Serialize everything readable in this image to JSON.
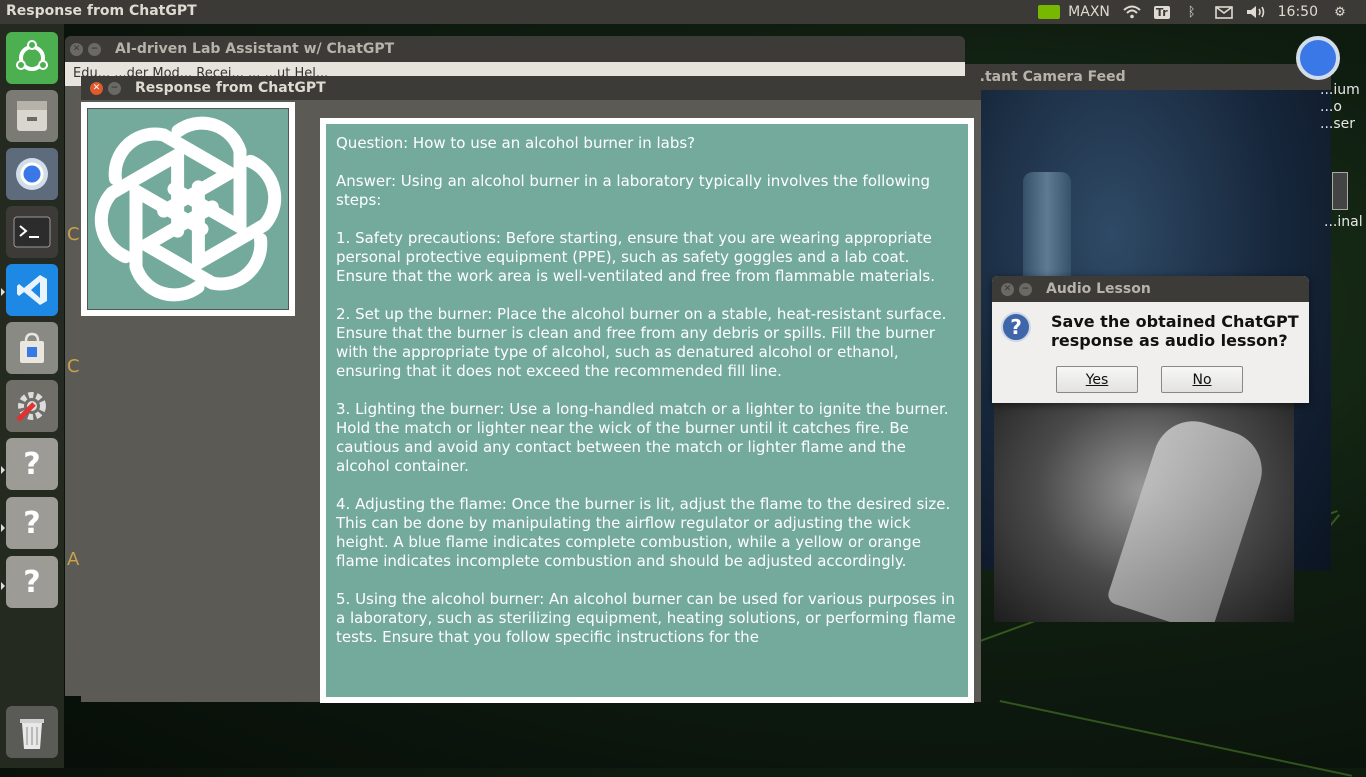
{
  "topbar": {
    "title": "Response from ChatGPT",
    "tray": {
      "maxn_label": "MAXN",
      "tr_label": "Tr",
      "time": "16:50"
    }
  },
  "launcher": {
    "items": [
      {
        "name": "ubuntu-dash-icon"
      },
      {
        "name": "files-icon"
      },
      {
        "name": "chromium-icon"
      },
      {
        "name": "terminal-icon"
      },
      {
        "name": "vscode-icon"
      },
      {
        "name": "software-center-icon"
      },
      {
        "name": "system-settings-icon"
      },
      {
        "name": "unknown-app-icon"
      },
      {
        "name": "unknown-app-icon"
      },
      {
        "name": "unknown-app-icon"
      },
      {
        "name": "trash-icon"
      }
    ]
  },
  "background_window": {
    "title": "AI-driven Lab Assistant w/ ChatGPT",
    "menu_text": "Edu... ...der Mod... Recei... ... ...ut Hel...",
    "side_chars": [
      "C",
      "C",
      "A"
    ]
  },
  "camera_window": {
    "title": "...tant Camera Feed"
  },
  "desktop": {
    "chromium_label_parts": [
      "...ium",
      "...o",
      "...ser"
    ],
    "terminal_label": "...inal"
  },
  "response_window": {
    "title": "Response from ChatGPT",
    "paragraphs": [
      "Question: How to use an alcohol burner in labs?",
      "Answer: Using an alcohol burner in a laboratory typically involves the following steps:",
      "1. Safety precautions: Before starting, ensure that you are wearing appropriate personal protective equipment (PPE), such as safety goggles and a lab coat. Ensure that the work area is well-ventilated and free from flammable materials.",
      "2. Set up the burner: Place the alcohol burner on a stable, heat-resistant surface. Ensure that the burner is clean and free from any debris or spills. Fill the burner with the appropriate type of alcohol, such as denatured alcohol or ethanol, ensuring that it does not exceed the recommended fill line.",
      "3. Lighting the burner: Use a long-handled match or a lighter to ignite the burner. Hold the match or lighter near the wick of the burner until it catches fire. Be cautious and avoid any contact between the match or lighter flame and the alcohol container.",
      "4. Adjusting the flame: Once the burner is lit, adjust the flame to the desired size. This can be done by manipulating the airflow regulator or adjusting the wick height. A blue flame indicates complete combustion, while a yellow or orange flame indicates incomplete combustion and should be adjusted accordingly.",
      "5. Using the alcohol burner: An alcohol burner can be used for various purposes in a laboratory, such as sterilizing equipment, heating solutions, or performing flame tests. Ensure that you follow specific instructions for the"
    ],
    "logo_color": "#74aa9c"
  },
  "audio_dialog": {
    "title": "Audio Lesson",
    "message": "Save the obtained ChatGPT response as audio lesson?",
    "yes_label": "Yes",
    "no_label": "No"
  }
}
